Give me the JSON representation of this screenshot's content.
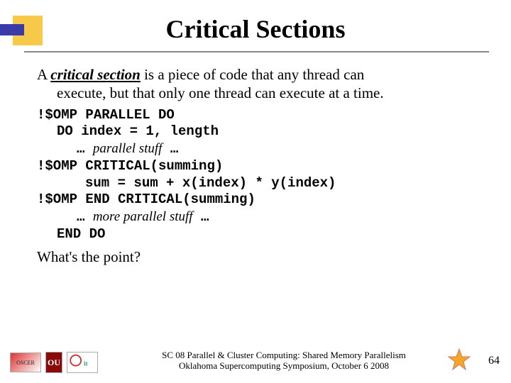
{
  "title": "Critical Sections",
  "intro": {
    "prefix": "A ",
    "term": "critical section",
    "rest": " is a piece of code that any thread can",
    "line2": "execute, but that only one thread can execute at a time."
  },
  "code": {
    "l1": "!$OMP PARALLEL DO",
    "l2": "DO index = 1, length",
    "l3_pre": "… ",
    "l3_comment": "parallel stuff",
    "l3_post": " …",
    "l4": "!$OMP CRITICAL(summing)",
    "l5": "sum = sum + x(index) * y(index)",
    "l6": "!$OMP END CRITICAL(summing)",
    "l7_pre": "… ",
    "l7_comment": "more parallel stuff",
    "l7_post": " …",
    "l8": "END DO"
  },
  "closing": "What's the point?",
  "footer": {
    "line1": "SC 08 Parallel & Cluster Computing: Shared Memory Parallelism",
    "line2": "Oklahoma Supercomputing Symposium, October 6 2008"
  },
  "logos": {
    "oscer": "OSCER",
    "ou": "OU",
    "it": "it"
  },
  "page": "64"
}
